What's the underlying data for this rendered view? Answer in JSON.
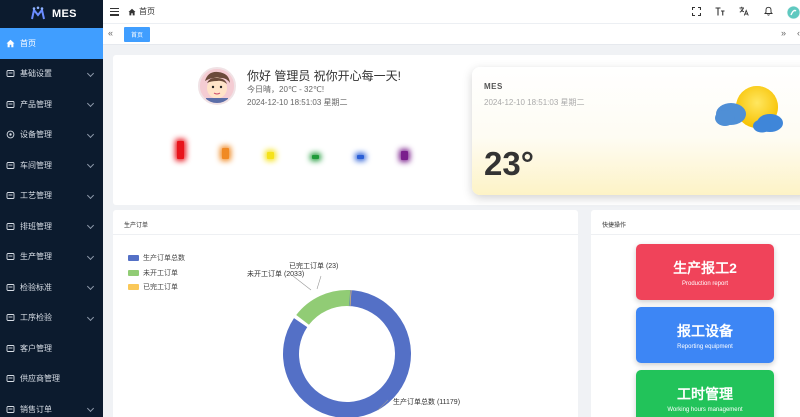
{
  "app": {
    "logo_text": "MES"
  },
  "sidebar": {
    "items": [
      {
        "label": "首页",
        "icon": "home-icon",
        "active": true,
        "expandable": false
      },
      {
        "label": "基础设置",
        "icon": "settings-icon",
        "active": false,
        "expandable": true
      },
      {
        "label": "产品管理",
        "icon": "chart-icon",
        "active": false,
        "expandable": true
      },
      {
        "label": "设备管理",
        "icon": "circle-icon",
        "active": false,
        "expandable": true
      },
      {
        "label": "车间管理",
        "icon": "workshop-icon",
        "active": false,
        "expandable": true
      },
      {
        "label": "工艺管理",
        "icon": "document-icon",
        "active": false,
        "expandable": true
      },
      {
        "label": "排班管理",
        "icon": "list-icon",
        "active": false,
        "expandable": true
      },
      {
        "label": "生产管理",
        "icon": "database-icon",
        "active": false,
        "expandable": true
      },
      {
        "label": "检验标准",
        "icon": "monitor-icon",
        "active": false,
        "expandable": true
      },
      {
        "label": "工序检验",
        "icon": "book-icon",
        "active": false,
        "expandable": true
      },
      {
        "label": "客户管理",
        "icon": "customer-icon",
        "active": false,
        "expandable": false
      },
      {
        "label": "供应商管理",
        "icon": "supplier-icon",
        "active": false,
        "expandable": false
      },
      {
        "label": "销售订单",
        "icon": "order-icon",
        "active": false,
        "expandable": true
      }
    ]
  },
  "header": {
    "breadcrumb": "首页",
    "icons": [
      "fullscreen-icon",
      "font-size-icon",
      "translate-icon",
      "bell-icon",
      "avatar"
    ]
  },
  "tabs": {
    "active_label": "首页"
  },
  "welcome": {
    "greeting": "你好 管理员 祝你开心每一天!",
    "weather": "今日晴，20℃ - 32℃!",
    "datetime": "2024-12-10 18:51:03 星期二",
    "glow_colors": [
      "#e8141c",
      "#f08a24",
      "#f5e21a",
      "#1f9a3a",
      "#2b5fd6",
      "#7a1f8c"
    ]
  },
  "weather_widget": {
    "title": "MES",
    "datetime": "2024-12-10 18:51:03 星期二",
    "temperature": "23°"
  },
  "orders": {
    "title": "生产订单",
    "labels": {
      "total": "生产订单总数 (11179)",
      "unstarted": "未开工订单 (2033)",
      "finished": "已完工订单 (23)"
    }
  },
  "chart_data": {
    "type": "pie",
    "title": "生产订单",
    "legend_position": "top-left",
    "donut": true,
    "series": [
      {
        "name": "生产订单总数",
        "value": 11179,
        "color": "#5470c6"
      },
      {
        "name": "未开工订单",
        "value": 2033,
        "color": "#91cc75"
      },
      {
        "name": "已完工订单",
        "value": 23,
        "color": "#fac858"
      }
    ]
  },
  "quick_ops": {
    "title": "快捷操作",
    "buttons": [
      {
        "title": "生产报工2",
        "subtitle": "Production report",
        "color": "#f0435a"
      },
      {
        "title": "报工设备",
        "subtitle": "Reporting equipment",
        "color": "#3d86f5"
      },
      {
        "title": "工时管理",
        "subtitle": "Working hours management",
        "color": "#22c35a"
      }
    ]
  }
}
